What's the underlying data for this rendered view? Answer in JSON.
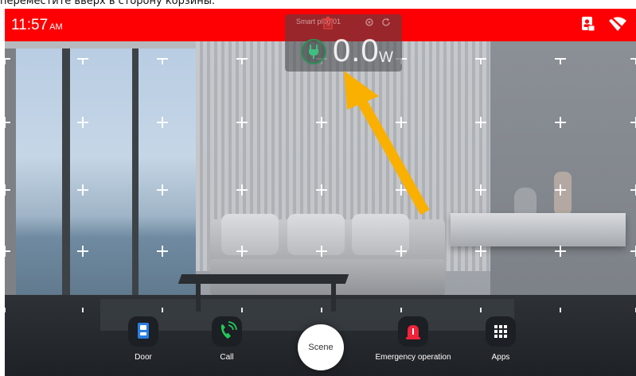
{
  "caption": "переместите вверх в сторону корзины.",
  "statusbar": {
    "time": "11:57",
    "ampm": "AM",
    "color": "#fe0003",
    "icons": [
      "contact-card-icon",
      "wifi-off-icon"
    ]
  },
  "widget": {
    "device_name": "Smart plug 01",
    "power_value": "0.0",
    "power_unit": "W",
    "icons": [
      "trash-icon",
      "plug-icon",
      "settings-icon",
      "refresh-icon"
    ]
  },
  "gesture": {
    "arrow_color": "#f9b000",
    "direction": "up-left toward trash"
  },
  "dock": {
    "items": [
      {
        "label": "Door",
        "icon": "door-icon"
      },
      {
        "label": "Call",
        "icon": "phone-icon"
      },
      {
        "label": "Scene",
        "icon": "scene-button"
      },
      {
        "label": "Emergency operation",
        "icon": "alarm-icon"
      },
      {
        "label": "Apps",
        "icon": "apps-grid-icon"
      }
    ]
  }
}
